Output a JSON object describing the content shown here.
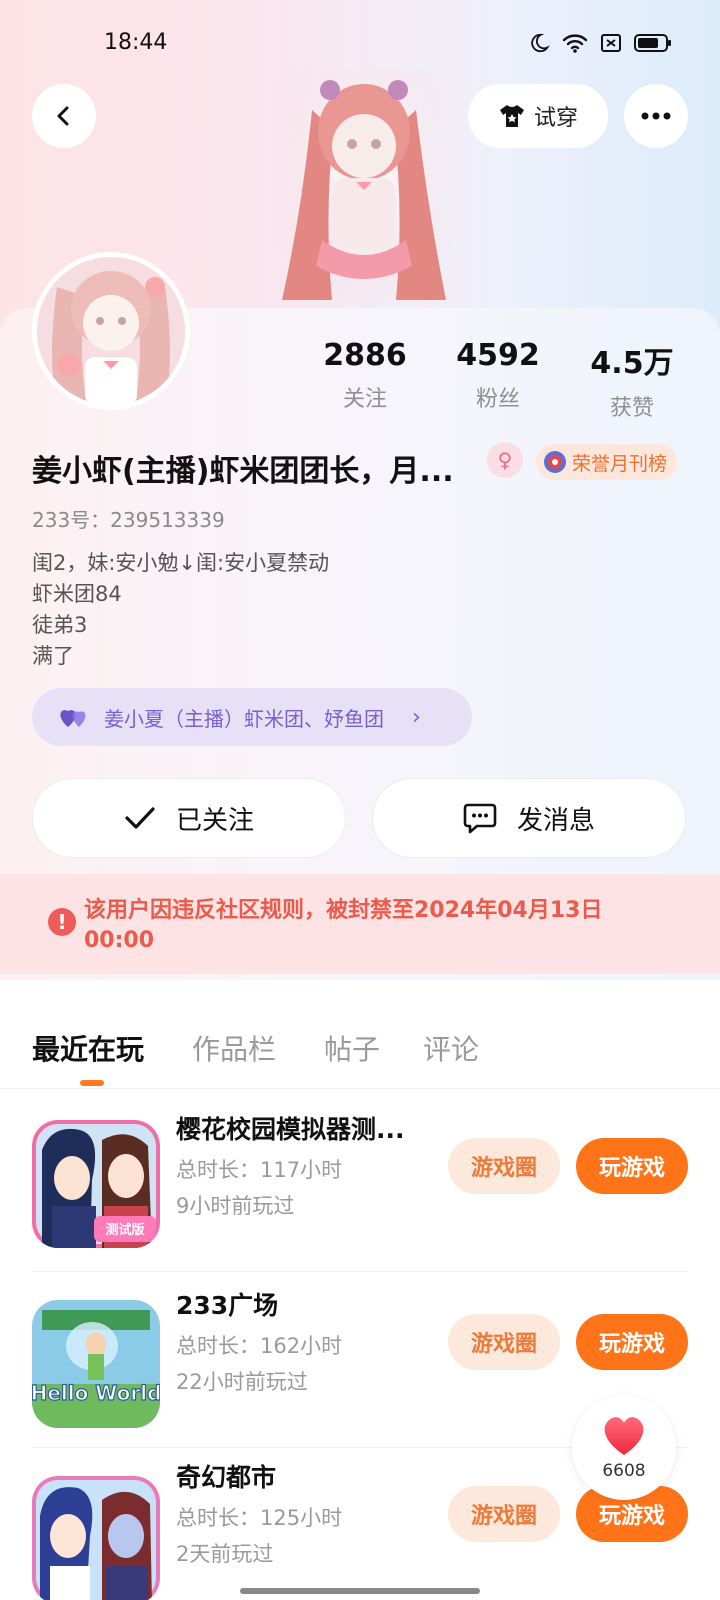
{
  "status": {
    "time": "18:44"
  },
  "header": {
    "try_on_label": "试穿"
  },
  "stats": [
    {
      "value": "2886",
      "label": "关注"
    },
    {
      "value": "4592",
      "label": "粉丝"
    },
    {
      "value": "4.5万",
      "label": "获赞"
    }
  ],
  "profile": {
    "name": "姜小虾(主播)虾米团团长，月...",
    "honor_badge": "荣誉月刊榜",
    "uid": "233号：239513339",
    "bio": [
      "闺2，妹:安小勉↓闺:安小夏禁动",
      "虾米团84",
      "徒弟3",
      "满了"
    ],
    "relation": "姜小夏（主播）虾米团、妤鱼团"
  },
  "actions": {
    "followed_label": "已关注",
    "message_label": "发消息"
  },
  "ban_notice": "该用户因违反社区规则，被封禁至2024年04月13日00:00",
  "tabs": [
    {
      "label": "最近在玩"
    },
    {
      "label": "作品栏"
    },
    {
      "label": "帖子"
    },
    {
      "label": "评论"
    }
  ],
  "games": [
    {
      "title": "樱花校园模拟器测...",
      "duration": "总时长：117小时",
      "last_played": "9小时前玩过",
      "icon_text": "测试版",
      "circle_label": "游戏圈",
      "play_label": "玩游戏"
    },
    {
      "title": "233广场",
      "duration": "总时长：162小时",
      "last_played": "22小时前玩过",
      "icon_text": "Hello World",
      "circle_label": "游戏圈",
      "play_label": "玩游戏"
    },
    {
      "title": "奇幻都市",
      "duration": "总时长：125小时",
      "last_played": "2天前玩过",
      "icon_text": "",
      "circle_label": "游戏圈",
      "play_label": "玩游戏"
    }
  ],
  "like_float": {
    "count": "6608"
  },
  "colors": {
    "accent": "#ff7419",
    "ban_text": "#ec5a4b",
    "relation": "#7a5fd0"
  }
}
